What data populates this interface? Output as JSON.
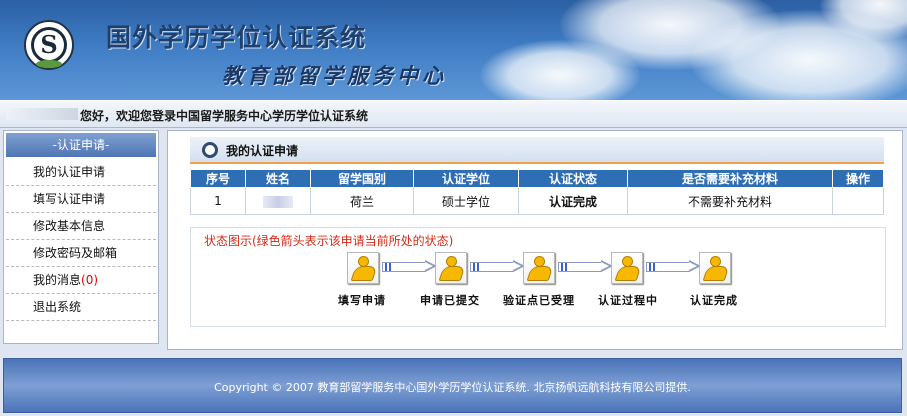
{
  "header": {
    "title": "国外学历学位认证系统",
    "subtitle": "教育部留学服务中心",
    "logo_letter": "S"
  },
  "welcome": {
    "text": "您好，欢迎您登录中国留学服务中心学历学位认证系统"
  },
  "sidebar": {
    "heading": "-认证申请-",
    "items": [
      {
        "label": "我的认证申请"
      },
      {
        "label": "填写认证申请"
      },
      {
        "label": "修改基本信息"
      },
      {
        "label": "修改密码及邮箱"
      },
      {
        "label": "我的消息",
        "count": "(0)"
      },
      {
        "label": "退出系统"
      }
    ]
  },
  "panel": {
    "title": "我的认证申请"
  },
  "table": {
    "columns": [
      "序号",
      "姓名",
      "留学国别",
      "认证学位",
      "认证状态",
      "是否需要补充材料",
      "操作"
    ],
    "rows": [
      {
        "index": "1",
        "name": "",
        "country": "荷兰",
        "degree": "硕士学位",
        "status": "认证完成",
        "supplement": "不需要补充材料",
        "action": ""
      }
    ]
  },
  "status_diagram": {
    "title": "状态图示(绿色箭头表示该申请当前所处的状态)",
    "steps": [
      "填写申请",
      "申请已提交",
      "验证点已受理",
      "认证过程中",
      "认证完成"
    ],
    "icon": "person-running-icon"
  },
  "footer": {
    "text": "Copyright © 2007 教育部留学服务中心国外学历学位认证系统. 北京扬帆远航科技有限公司提供."
  },
  "colors": {
    "table_header": "#2e6eb5",
    "accent_line": "#f2a14a",
    "status_title": "#d62b14",
    "message_count": "#ee0000"
  }
}
